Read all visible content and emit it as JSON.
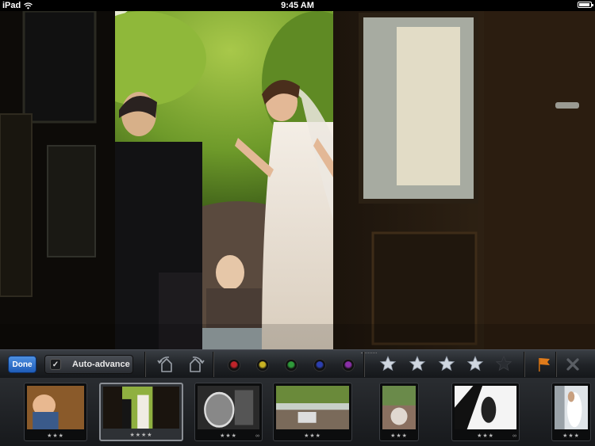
{
  "status_bar": {
    "device": "iPad",
    "time": "9:45 AM",
    "battery_level": 0.95
  },
  "photo": {
    "description_icon": "photo-image"
  },
  "toolbar": {
    "done_label": "Done",
    "auto_advance_label": "Auto-advance",
    "auto_advance_checked": true,
    "rotate_left_icon": "rotate-left-icon",
    "rotate_right_icon": "rotate-right-icon",
    "color_labels": [
      {
        "name": "red",
        "color": "#c0242a"
      },
      {
        "name": "yellow",
        "color": "#c9b323"
      },
      {
        "name": "green",
        "color": "#2f9a3a"
      },
      {
        "name": "blue",
        "color": "#2c3fb0"
      },
      {
        "name": "purple",
        "color": "#8a2fa8"
      }
    ],
    "rating": 4,
    "max_rating": 5,
    "flag_color": "#e07b1a"
  },
  "filmstrip": {
    "thumbnails": [
      {
        "id": "t1",
        "stars": "★★★",
        "selected": false,
        "linked": false
      },
      {
        "id": "t2",
        "stars": "★★★★",
        "selected": true,
        "linked": false
      },
      {
        "id": "t3",
        "stars": "★★★",
        "selected": false,
        "linked": true
      },
      {
        "id": "t4",
        "stars": "★★★",
        "selected": false,
        "linked": false
      },
      {
        "id": "t5",
        "stars": "★★★",
        "selected": false,
        "linked": false
      },
      {
        "id": "t6",
        "stars": "★★★",
        "selected": false,
        "linked": true
      },
      {
        "id": "t7",
        "stars": "★★★",
        "selected": false,
        "linked": false
      }
    ]
  }
}
